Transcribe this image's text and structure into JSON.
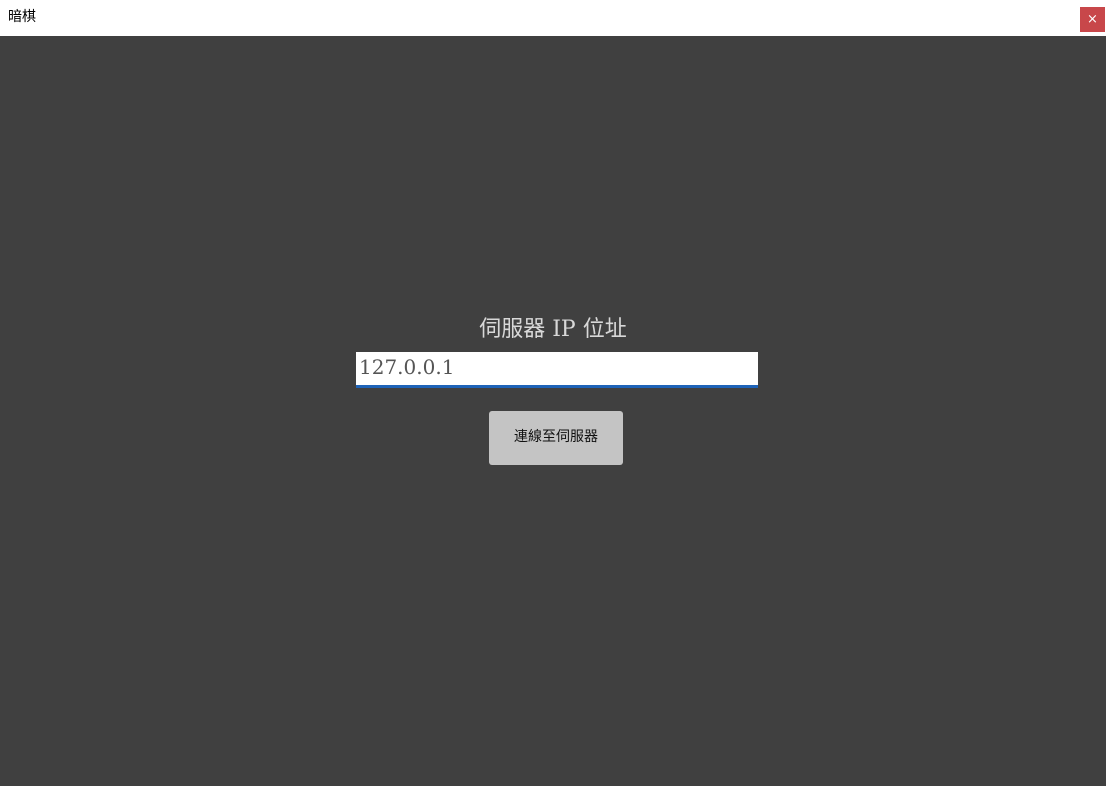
{
  "window": {
    "title": "暗棋",
    "close_glyph": "×"
  },
  "connect_form": {
    "label": "伺服器 IP 位址",
    "ip_value": "127.0.0.1",
    "connect_button_label": "連線至伺服器"
  },
  "colors": {
    "background": "#404040",
    "titlebar": "#ffffff",
    "close_button": "#c8474a",
    "input_underline": "#1e63b8",
    "button": "#c4c4c4"
  }
}
